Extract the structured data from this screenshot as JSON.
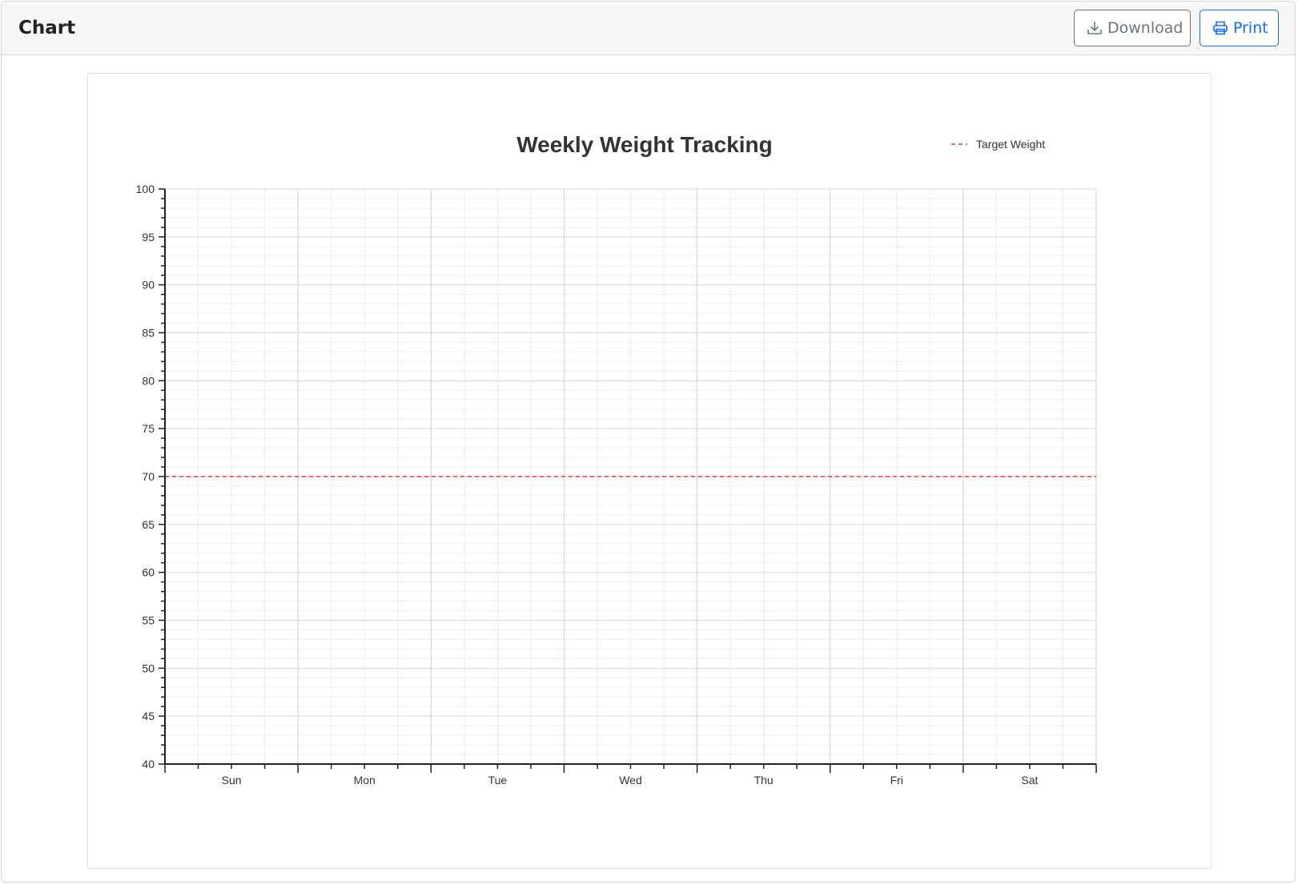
{
  "header": {
    "title": "Chart",
    "download_label": "Download",
    "print_label": "Print",
    "download_icon": "download-icon",
    "print_icon": "printer-icon"
  },
  "chart_data": {
    "type": "line",
    "title": "Weekly Weight Tracking",
    "xlabel": "",
    "ylabel": "",
    "categories": [
      "Sun",
      "Mon",
      "Tue",
      "Wed",
      "Thu",
      "Fri",
      "Sat"
    ],
    "ylim": [
      40,
      100
    ],
    "yticks": [
      40,
      45,
      50,
      55,
      60,
      65,
      70,
      75,
      80,
      85,
      90,
      95,
      100
    ],
    "grid": true,
    "legend": {
      "placement": "top-right",
      "entries": [
        "Target Weight"
      ]
    },
    "series": [
      {
        "name": "Target Weight",
        "style": "dashed",
        "color": "#ff4d4d",
        "values": [
          70,
          70,
          70,
          70,
          70,
          70,
          70
        ]
      }
    ]
  }
}
